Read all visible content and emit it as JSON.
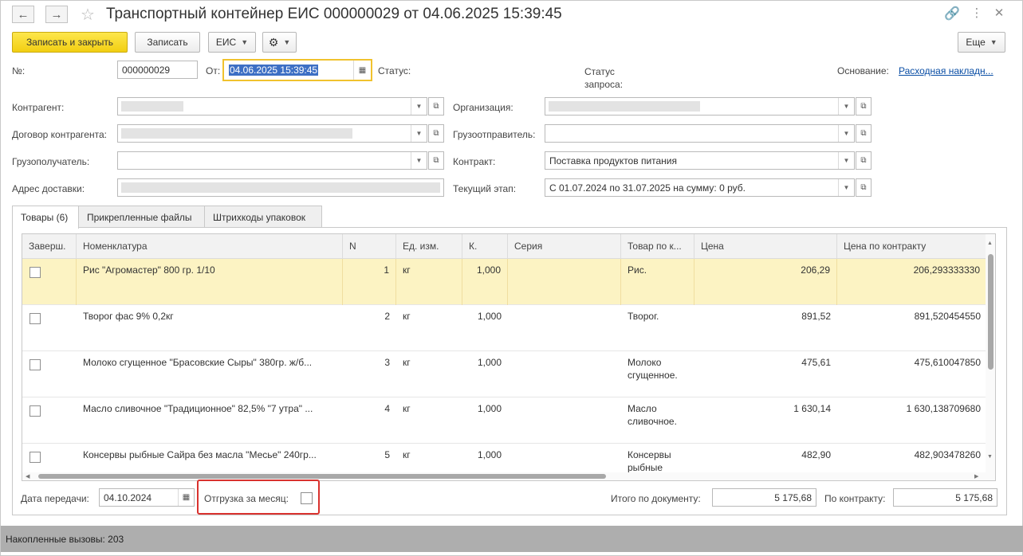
{
  "window": {
    "title": "Транспортный контейнер ЕИС 000000029 от 04.06.2025 15:39:45"
  },
  "toolbar": {
    "save_close_label": "Записать и закрыть",
    "save_label": "Записать",
    "eis_label": "ЕИС",
    "more_label": "Еще"
  },
  "form": {
    "number_label": "№:",
    "number_value": "000000029",
    "from_label": "От:",
    "from_value": "04.06.2025 15:39:45",
    "status_label": "Статус:",
    "request_status_label": "Статус запроса:",
    "basis_label": "Основание:",
    "basis_link": "Расходная накладн...",
    "counterparty_label": "Контрагент:",
    "contract_counterparty_label": "Договор контрагента:",
    "consignee_label": "Грузополучатель:",
    "delivery_address_label": "Адрес доставки:",
    "organization_label": "Организация:",
    "shipper_label": "Грузоотправитель:",
    "contract_label": "Контракт:",
    "contract_value": "Поставка продуктов питания",
    "stage_label": "Текущий этап:",
    "stage_value": "С 01.07.2024 по 31.07.2025 на сумму: 0 руб."
  },
  "tabs": [
    {
      "label": "Товары (6)"
    },
    {
      "label": "Прикрепленные файлы"
    },
    {
      "label": "Штрихкоды упаковок"
    }
  ],
  "table": {
    "columns": [
      "Заверш.",
      "Номенклатура",
      "N",
      "Ед. изм.",
      "К.",
      "Серия",
      "Товар по к...",
      "Цена",
      "Цена по контракту"
    ],
    "rows": [
      {
        "name": "Рис \"Агромастер\" 800 гр. 1/10",
        "n": "1",
        "unit": "кг",
        "k": "1,000",
        "series": "",
        "product": "Рис.",
        "price": "206,29",
        "contract_price": "206,293333330"
      },
      {
        "name": "Творог фас 9% 0,2кг",
        "n": "2",
        "unit": "кг",
        "k": "1,000",
        "series": "",
        "product": "Творог.",
        "price": "891,52",
        "contract_price": "891,520454550"
      },
      {
        "name": "Молоко сгущенное \"Брасовские Сыры\" 380гр. ж/б...",
        "n": "3",
        "unit": "кг",
        "k": "1,000",
        "series": "",
        "product": "Молоко сгущенное.",
        "price": "475,61",
        "contract_price": "475,610047850"
      },
      {
        "name": "Масло сливочное \"Традиционное\" 82,5% \"7 утра\" ...",
        "n": "4",
        "unit": "кг",
        "k": "1,000",
        "series": "",
        "product": "Масло сливочное.",
        "price": "1 630,14",
        "contract_price": "1 630,138709680"
      },
      {
        "name": "Консервы рыбные Сайра без масла \"Месье\" 240гр...",
        "n": "5",
        "unit": "кг",
        "k": "1,000",
        "series": "",
        "product": "Консервы рыбные",
        "price": "482,90",
        "contract_price": "482,903478260"
      }
    ]
  },
  "footer": {
    "transfer_date_label": "Дата передачи:",
    "transfer_date_value": "04.10.2024",
    "monthly_shipment_label": "Отгрузка за месяц:",
    "total_doc_label": "Итого по документу:",
    "total_doc_value": "5 175,68",
    "by_contract_label": "По контракту:",
    "by_contract_value": "5 175,68"
  },
  "status_bar": {
    "text": "Накопленные вызовы: 203"
  },
  "colors": {
    "primary_button": "#f2cf12",
    "selected_row": "#fcf3c3",
    "highlight_border": "#d9322e",
    "focus_border": "#f0c22e",
    "link": "#0a4ea5"
  }
}
